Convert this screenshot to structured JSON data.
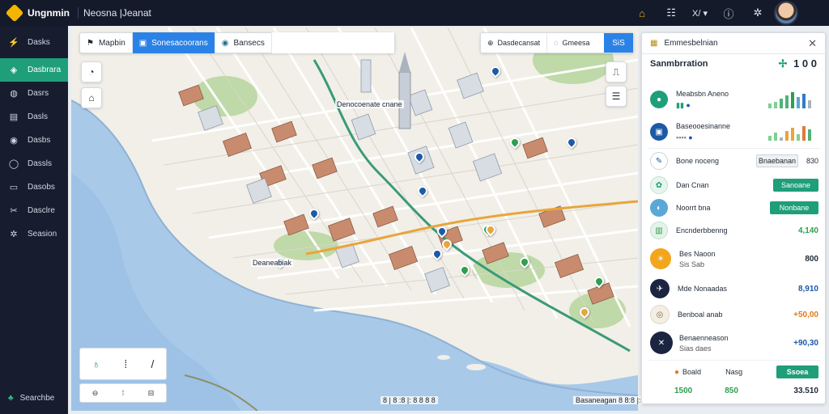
{
  "app": {
    "logo_text": "Ungnmin",
    "window_title": "Neosna |Jeanat"
  },
  "topbar": {
    "icons": [
      "home-icon",
      "grid-icon",
      "translate-icon",
      "info-icon",
      "settings-icon"
    ],
    "translate_label": "X/ ▾"
  },
  "sidebar": {
    "items": [
      {
        "label": "Dasks",
        "icon": "dashboard-icon"
      },
      {
        "label": "Dasbrara",
        "icon": "analytics-icon",
        "active": true
      },
      {
        "label": "Dasrs",
        "icon": "shield-icon"
      },
      {
        "label": "Dasls",
        "icon": "document-icon"
      },
      {
        "label": "Dasbs",
        "icon": "camera-icon"
      },
      {
        "label": "Dassls",
        "icon": "globe-icon"
      },
      {
        "label": "Dasobs",
        "icon": "monitor-icon"
      },
      {
        "label": "Dasclre",
        "icon": "tools-icon"
      },
      {
        "label": "Seasion",
        "icon": "gear-icon"
      }
    ],
    "footer_label": "Searchbe"
  },
  "map_toolbar": {
    "items": [
      {
        "label": "Mapbin",
        "icon": "marker-icon"
      },
      {
        "label": "Sonesacoorans",
        "icon": "layers-icon",
        "active": true
      },
      {
        "label": "Bansecs",
        "icon": "compass-icon"
      }
    ],
    "input_value": ""
  },
  "map_search": {
    "part1": "Dasdecansat",
    "part2": "Gmeesa",
    "button": "SiS"
  },
  "map": {
    "labels": [
      {
        "text": "Denocoenate cnane"
      },
      {
        "text": "Deaneabiak"
      }
    ],
    "legend_glyphs": [
      "♁",
      "⁞",
      "/"
    ],
    "scale_glyphs": [
      "⊖",
      "⁞",
      "⊟"
    ],
    "attribution_left": "8 | 8 :8 |: 8 8 8 8",
    "attribution_right": "Basaneagan 8 8:8 |:8"
  },
  "panel": {
    "title": "Emmesbelnian",
    "summary_label": "Sanmbrration",
    "summary_value": "1 0 0",
    "rows": [
      {
        "label": "Meabsbn Aneno",
        "value": "",
        "icon_color": "#1f9e7a",
        "kind": "chart-green"
      },
      {
        "label": "Baseooesinanne",
        "value": "",
        "icon_color": "#1c5aa8",
        "kind": "chart-mixed"
      },
      {
        "label": "Bone noceng",
        "value": "830 \b",
        "icon_color": "#ffffff",
        "kind": "button-gray",
        "button": "Bnaebanan"
      },
      {
        "label": "Dan Cnan",
        "value": "",
        "icon_color": "#e8f5ee",
        "kind": "button-green",
        "button": "Sanoane"
      },
      {
        "label": "Noorrt bna",
        "value": "",
        "icon_color": "#2f7dc2",
        "kind": "button-green",
        "button": "Nonbane"
      },
      {
        "label": "Encnderbbenng",
        "value": "4,140",
        "icon_color": "#e5f3e8",
        "kind": "value-green"
      },
      {
        "label": "Bes Naoon",
        "sublabel": "Sis Sab",
        "value": "800",
        "icon_color": "#f3a51b",
        "kind": "value-dark"
      },
      {
        "label": "Mde Nonaadas",
        "value": "8,910",
        "icon_color": "#1b2440",
        "kind": "value-blue"
      },
      {
        "label": "Benboal anab",
        "value": "+50,00",
        "icon_color": "#f3efe6",
        "kind": "value-orange"
      },
      {
        "label": "Benaenneason",
        "sublabel": "Sias daes",
        "value": "+90,30",
        "icon_color": "#1b2440",
        "kind": "value-blue"
      }
    ],
    "footer": {
      "label_left": "Boald",
      "label_mid": "Nasg",
      "button": "Ssoea",
      "values": [
        "1500",
        "850",
        "33.510"
      ]
    }
  },
  "colors": {
    "accent": "#1f9e7a",
    "primary_blue": "#2b82e6",
    "water": "#a9c9e8",
    "park": "#bfd9a8",
    "route_green": "#3b9a77",
    "route_orange": "#e8a53c"
  }
}
